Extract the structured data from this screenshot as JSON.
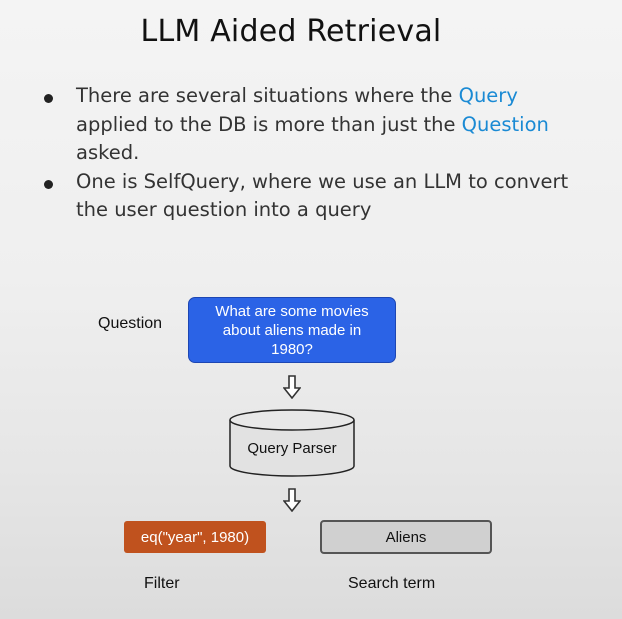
{
  "title": "LLM Aided Retrieval",
  "bullets": [
    {
      "part1": "There are several situations where the ",
      "hl1": "Query",
      "part2": " applied to the DB is more than just the ",
      "hl2": "Question",
      "part3": " asked."
    },
    {
      "text": "One is SelfQuery, where we use an LLM to convert the user question into a query"
    }
  ],
  "diagram": {
    "question_label": "Question",
    "question_text": "What are some movies about aliens made in 1980?",
    "parser_label": "Query Parser",
    "filter_value": "eq(\"year\", 1980)",
    "filter_label": "Filter",
    "search_value": "Aliens",
    "search_label": "Search term"
  },
  "colors": {
    "highlight": "#1a8ad4",
    "question_box": "#2b63e6",
    "filter_box": "#c0521e",
    "search_box": "#d0d0d0"
  }
}
